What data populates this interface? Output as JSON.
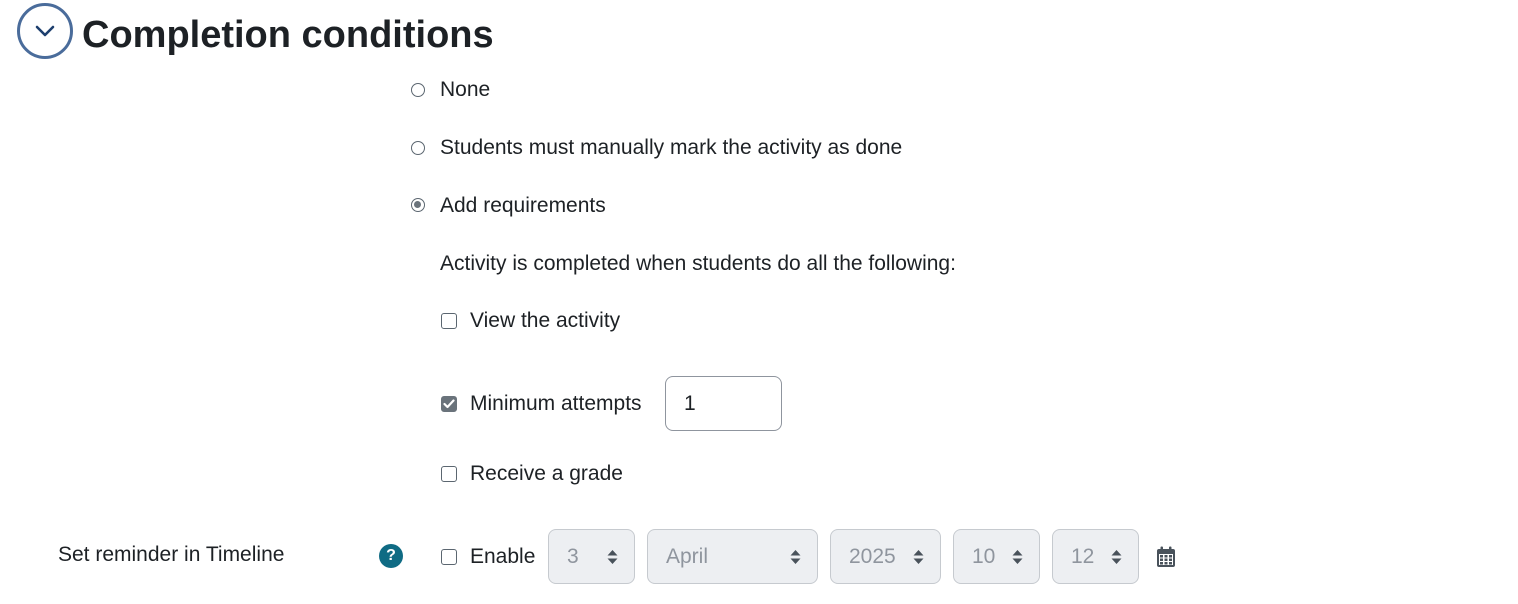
{
  "section": {
    "title": "Completion conditions",
    "collapse_icon": "chevron-down-icon"
  },
  "completion_options": [
    {
      "label": "None",
      "selected": false
    },
    {
      "label": "Students must manually mark the activity as done",
      "selected": false
    },
    {
      "label": "Add requirements",
      "selected": true
    }
  ],
  "requirements": {
    "intro": "Activity is completed when students do all the following:",
    "view_activity": {
      "label": "View the activity",
      "checked": false
    },
    "minimum_attempts": {
      "label": "Minimum attempts",
      "checked": true,
      "value": "1"
    },
    "receive_grade": {
      "label": "Receive a grade",
      "checked": false
    }
  },
  "reminder": {
    "label": "Set reminder in Timeline",
    "help_icon": "question-circle-icon",
    "help_glyph": "?",
    "enable": {
      "label": "Enable",
      "checked": false
    },
    "day": "3",
    "month": "April",
    "year": "2025",
    "hour": "10",
    "minute": "12",
    "calendar_icon": "calendar-icon"
  },
  "colors": {
    "collapse_border": "#4a6c9b",
    "help_icon_bg": "#0f6b84",
    "disabled_select_bg": "#edeff2"
  }
}
